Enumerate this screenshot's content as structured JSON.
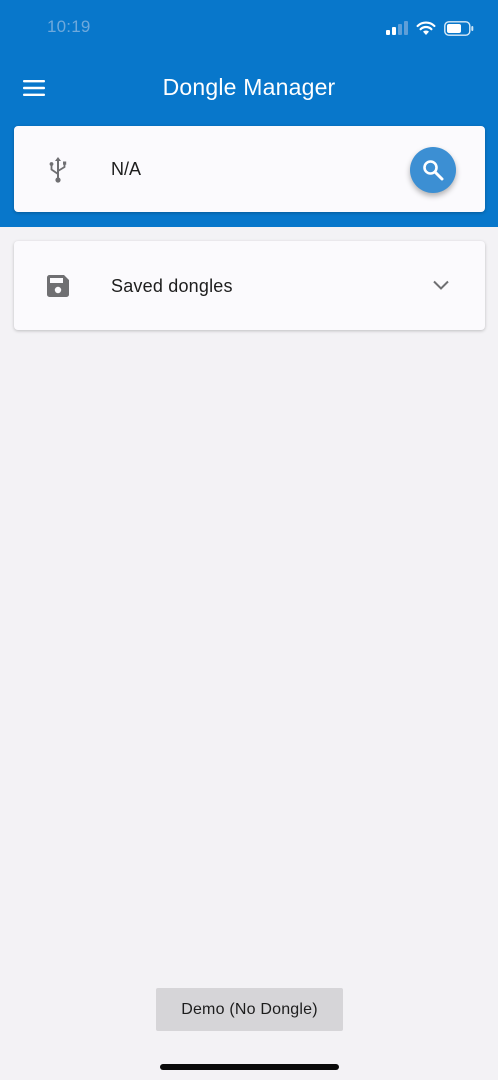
{
  "status_bar": {
    "time": "10:19",
    "icons": [
      "cellular-signal-icon",
      "wifi-icon",
      "battery-icon"
    ]
  },
  "app_bar": {
    "title": "Dongle Manager",
    "menu_icon": "hamburger-menu-icon"
  },
  "dongle_card": {
    "icon": "usb-icon",
    "value": "N/A",
    "action_icon": "search-icon"
  },
  "saved_dongles": {
    "icon": "save-icon",
    "label": "Saved dongles",
    "expand_icon": "chevron-down-icon",
    "expanded": false
  },
  "demo_button": {
    "label": "Demo (No Dongle)"
  },
  "colors": {
    "primary": "#0877cb",
    "fab": "#3c8fd3",
    "background": "#f3f2f5",
    "card": "#fbfafd",
    "demo_button": "#d6d5d8"
  }
}
